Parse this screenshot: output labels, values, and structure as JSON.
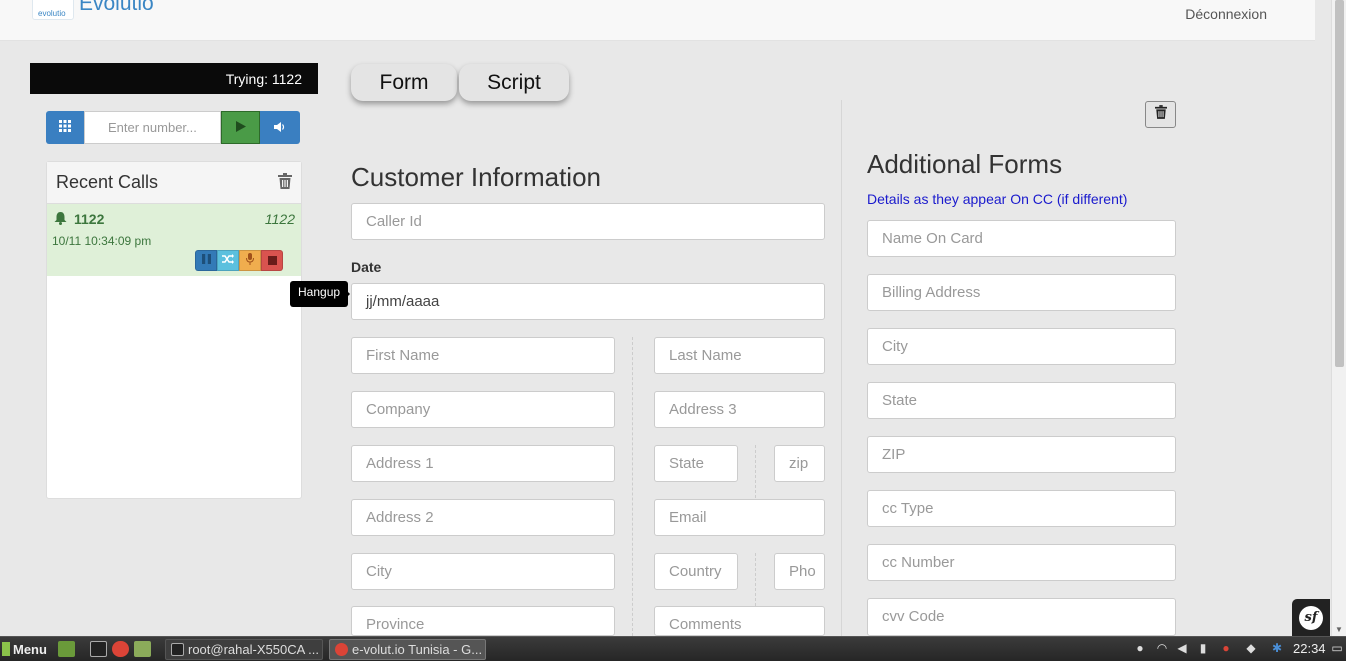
{
  "navbar": {
    "brand": "Evolutio",
    "logo_text": "evolutio",
    "logout_label": "Déconnexion"
  },
  "softphone": {
    "status_text": "Trying: 1122",
    "number_placeholder": "Enter number...",
    "recent_calls_title": "Recent Calls",
    "recent_calls": [
      {
        "number": "1122",
        "number_right": "1122",
        "datetime": "10/11 10:34:09 pm"
      }
    ],
    "hangup_tooltip": "Hangup"
  },
  "tabs": [
    {
      "label": "Form"
    },
    {
      "label": "Script"
    }
  ],
  "customer_form": {
    "title": "Customer Information",
    "caller_id_placeholder": "Caller Id",
    "date_label": "Date",
    "date_value": "jj/mm/aaaa",
    "first_name_placeholder": "First Name",
    "last_name_placeholder": "Last Name",
    "company_placeholder": "Company",
    "address3_placeholder": "Address 3",
    "address1_placeholder": "Address 1",
    "state_placeholder": "State",
    "zip_placeholder": "zip",
    "address2_placeholder": "Address 2",
    "email_placeholder": "Email",
    "city_placeholder": "City",
    "country_placeholder": "Country",
    "phone_placeholder": "Pho",
    "province_placeholder": "Province",
    "comments_placeholder": "Comments"
  },
  "additional_forms": {
    "title": "Additional Forms",
    "note": "Details as they appear On CC (if different)",
    "fields": [
      "Name On Card",
      "Billing Address",
      "City",
      "State",
      "ZIP",
      "cc Type",
      "cc Number",
      "cvv Code"
    ]
  },
  "taskbar": {
    "menu_label": "Menu",
    "windows": [
      {
        "label": "root@rahal-X550CA ..."
      },
      {
        "label": "e-volut.io Tunisia - G..."
      }
    ],
    "clock": "22:34"
  },
  "colors": {
    "brand_blue": "#3a86c4",
    "call_green_bg": "#dff0d8",
    "call_green_text": "#3c763d",
    "note_blue": "#1a1acd"
  }
}
